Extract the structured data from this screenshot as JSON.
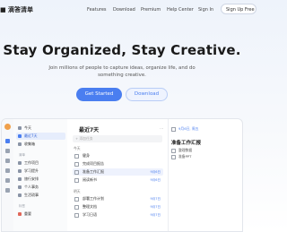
{
  "nav": {
    "logo": "■ 滴答清单",
    "links": [
      "Features",
      "Download",
      "Premium",
      "Help Center",
      "Sign In"
    ],
    "signup": "Sign Up Free"
  },
  "hero": {
    "title": "Stay Organized, Stay Creative.",
    "subtitle": "Join millions of people to capture ideas, organize life, and do something creative.",
    "primary_cta": "Get Started",
    "secondary_cta": "Download"
  },
  "app": {
    "sidebar": {
      "items": [
        {
          "label": "今天",
          "count": ""
        },
        {
          "label": "最近7天",
          "count": ""
        },
        {
          "label": "收集箱",
          "count": ""
        }
      ],
      "section_lists": "清单",
      "lists": [
        {
          "label": "工作项目",
          "count": ""
        },
        {
          "label": "学习提升",
          "count": ""
        },
        {
          "label": "旅行安排",
          "count": ""
        },
        {
          "label": "个人事务",
          "count": ""
        },
        {
          "label": "生活琐事",
          "count": ""
        }
      ],
      "section_tags": "标签",
      "tags": [
        {
          "label": "重要",
          "count": ""
        }
      ]
    },
    "list": {
      "title": "最近7天",
      "add_placeholder": "+ 添加任务",
      "groups": [
        {
          "name": "今天",
          "tasks": [
            {
              "title": "健身",
              "due": ""
            },
            {
              "title": "完成项目报告",
              "due": ""
            },
            {
              "title": "准备工作汇报",
              "due": "9月6日"
            },
            {
              "title": "阅读新书",
              "due": "9月6日"
            }
          ]
        },
        {
          "name": "明天",
          "tasks": [
            {
              "title": "部署工作计划",
              "due": "9月7日"
            },
            {
              "title": "整理文档",
              "due": "9月7日"
            },
            {
              "title": "学习日语",
              "due": "9月7日"
            }
          ]
        }
      ]
    },
    "detail": {
      "date": "9月6日, 周五",
      "title": "准备工作汇报",
      "subtasks": [
        "整理数据",
        "准备PPT"
      ]
    }
  }
}
